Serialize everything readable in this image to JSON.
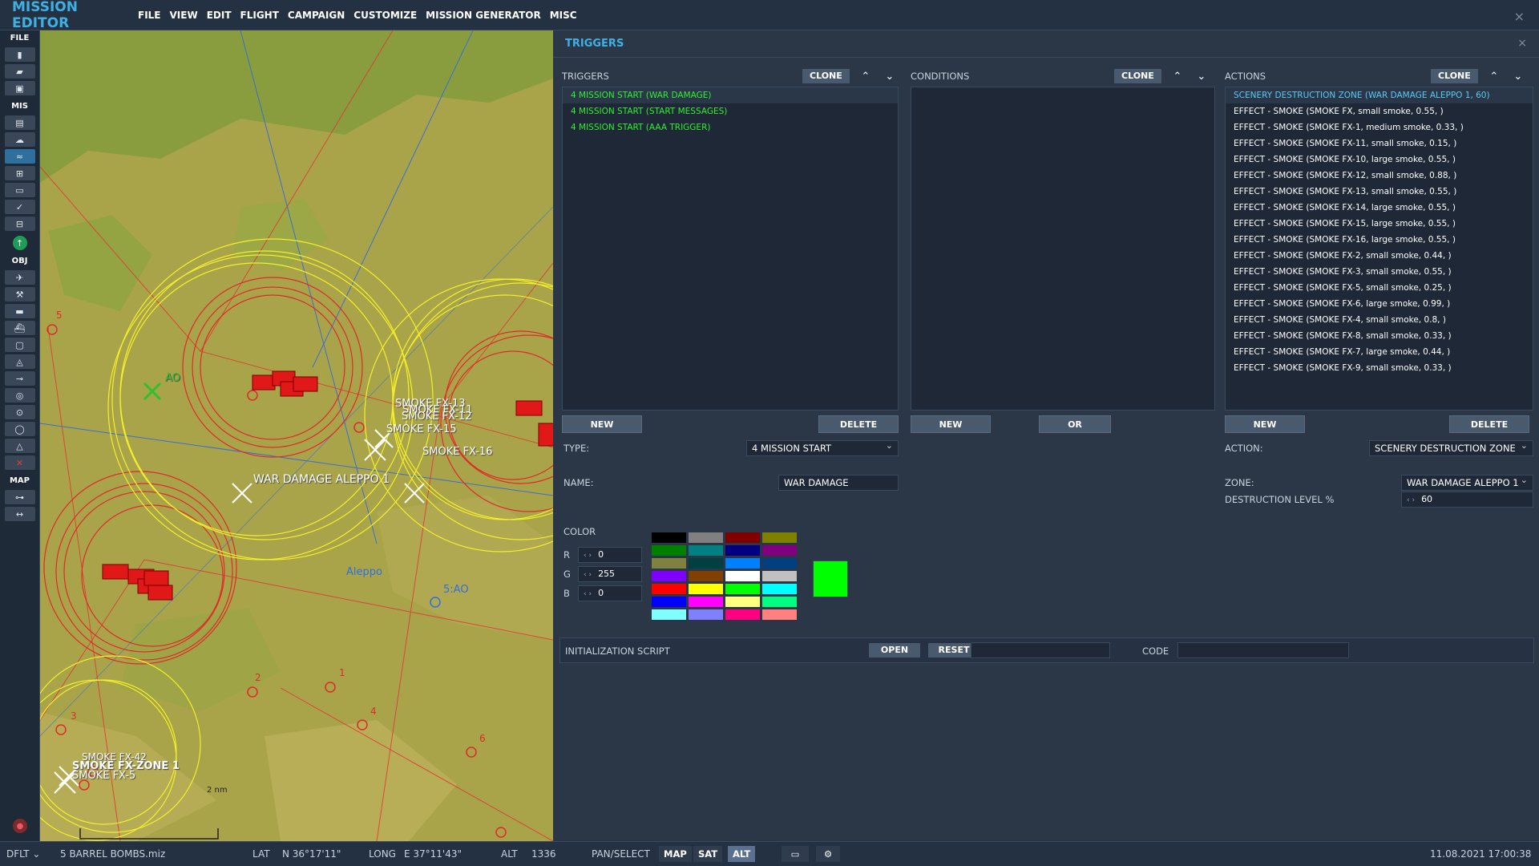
{
  "app": {
    "title": "MISSION EDITOR",
    "close_icon": "×"
  },
  "menu": [
    "FILE",
    "VIEW",
    "EDIT",
    "FLIGHT",
    "CAMPAIGN",
    "CUSTOMIZE",
    "MISSION GENERATOR",
    "MISC"
  ],
  "toolbar": {
    "sections": {
      "file": "FILE",
      "mis": "MIS",
      "obj": "OBJ",
      "map": "MAP"
    },
    "file_icons": [
      "new-file-icon",
      "open-file-icon",
      "save-file-icon"
    ],
    "mis_icons": [
      "briefing-icon",
      "weather-icon",
      "triggers-icon",
      "goals-icon",
      "options-icon",
      "check-icon",
      "route-planner-icon"
    ],
    "obj_icons": [
      "airplane-icon",
      "helicopter-icon",
      "ground-unit-icon",
      "ship-icon",
      "static-object-icon",
      "template-icon",
      "trigger-zone-icon",
      "nav-point-icon",
      "weapon-target-icon",
      "airbase-icon",
      "shapes-icon",
      "delete-icon"
    ],
    "map_icons": [
      "map-options-icon",
      "ruler-icon"
    ]
  },
  "map": {
    "labels": {
      "ao": "AO",
      "ao5": "5:AO",
      "aleppo": "Aleppo",
      "war_damage": "WAR DAMAGE ALEPPO 1",
      "smoke13": "SMOKE FX-13",
      "smoke11": "SMOKE FX-11",
      "smoke12": "SMOKE FX-12",
      "smoke15": "SMOKE FX-15",
      "smoke16": "SMOKE FX-16",
      "smoke_zone": "SMOKE FX-ZONE 1",
      "smoke42": "SMOKE FX-42",
      "smoke5": "SMOKE FX-5",
      "scale": "2 nm",
      "num1": "1",
      "num2": "2",
      "num3": "3",
      "num4": "4",
      "num5": "5",
      "num6": "6"
    }
  },
  "panel": {
    "title": "TRIGGERS",
    "close_icon": "×",
    "triggers": {
      "label": "TRIGGERS",
      "clone": "CLONE",
      "items": [
        "4 MISSION START (WAR DAMAGE)",
        "4 MISSION START (START MESSAGES)",
        "4 MISSION START (AAA TRIGGER)"
      ],
      "new": "NEW",
      "delete": "DELETE"
    },
    "conditions": {
      "label": "CONDITIONS",
      "clone": "CLONE",
      "new": "NEW",
      "or": "OR"
    },
    "actions": {
      "label": "ACTIONS",
      "clone": "CLONE",
      "items": [
        "SCENERY DESTRUCTION ZONE (WAR DAMAGE ALEPPO 1, 60)",
        "EFFECT - SMOKE (SMOKE FX, small smoke, 0.55, )",
        "EFFECT - SMOKE (SMOKE FX-1, medium smoke, 0.33, )",
        "EFFECT - SMOKE (SMOKE FX-11, small smoke, 0.15, )",
        "EFFECT - SMOKE (SMOKE FX-10, large smoke, 0.55, )",
        "EFFECT - SMOKE (SMOKE FX-12, small smoke, 0.88, )",
        "EFFECT - SMOKE (SMOKE FX-13, small smoke, 0.55, )",
        "EFFECT - SMOKE (SMOKE FX-14, large smoke, 0.55, )",
        "EFFECT - SMOKE (SMOKE FX-15, large smoke, 0.55, )",
        "EFFECT - SMOKE (SMOKE FX-16, large smoke, 0.55, )",
        "EFFECT - SMOKE (SMOKE FX-2, small smoke, 0.44, )",
        "EFFECT - SMOKE (SMOKE FX-3, small smoke, 0.55, )",
        "EFFECT - SMOKE (SMOKE FX-5, small smoke, 0.25, )",
        "EFFECT - SMOKE (SMOKE FX-6, large smoke, 0.99, )",
        "EFFECT - SMOKE (SMOKE FX-4, small smoke, 0.8, )",
        "EFFECT - SMOKE (SMOKE FX-8, small smoke, 0.33, )",
        "EFFECT - SMOKE (SMOKE FX-7, large smoke, 0.44, )",
        "EFFECT - SMOKE (SMOKE FX-9, small smoke, 0.33, )"
      ],
      "new": "NEW",
      "delete": "DELETE"
    },
    "type_label": "TYPE:",
    "type_value": "4 MISSION START",
    "name_label": "NAME:",
    "name_value": "WAR DAMAGE",
    "color_label": "COLOR",
    "r_label": "R",
    "r_value": "0",
    "g_label": "G",
    "g_value": "255",
    "b_label": "B",
    "b_value": "0",
    "palette": [
      "#000000",
      "#808080",
      "#800000",
      "#808000",
      "#008000",
      "#008080",
      "#000080",
      "#800080",
      "#808040",
      "#004040",
      "#0080ff",
      "#004080",
      "#8000ff",
      "#804000",
      "#ffffff",
      "#c0c0c0",
      "#ff0000",
      "#ffff00",
      "#00ff00",
      "#00ffff",
      "#0000ff",
      "#ff00ff",
      "#ffff80",
      "#00ff80",
      "#80ffff",
      "#8080ff",
      "#ff0080",
      "#ff8080"
    ],
    "selected_color": "#00ff00",
    "action_label": "ACTION:",
    "action_value": "SCENERY DESTRUCTION ZONE",
    "zone_label": "ZONE:",
    "zone_value": "WAR DAMAGE ALEPPO 1",
    "destruction_label": "DESTRUCTION LEVEL %",
    "destruction_value": "60",
    "init_script_label": "INITIALIZATION SCRIPT",
    "open": "OPEN",
    "reset": "RESET",
    "code_label": "CODE"
  },
  "status": {
    "profile": "DFLT",
    "file": "5 BARREL BOMBS.miz",
    "lat_label": "LAT",
    "lat_value": "N 36°17'11\"",
    "long_label": "LONG",
    "long_value": "E 37°11'43\"",
    "alt_label": "ALT",
    "alt_value": "1336",
    "pan_select": "PAN/SELECT",
    "map_btn": "MAP",
    "sat_btn": "SAT",
    "alt_btn": "ALT",
    "datetime": "11.08.2021 17:00:38"
  }
}
